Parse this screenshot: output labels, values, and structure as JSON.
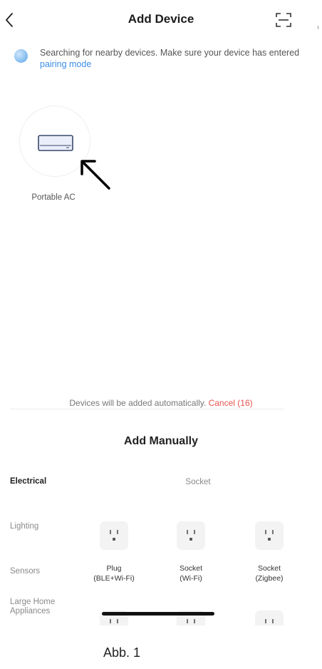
{
  "header": {
    "title": "Add Device",
    "back_icon": "chevron-left-icon",
    "scan_icon": "scan-icon"
  },
  "notice": {
    "text": "Searching for nearby devices. Make sure your device has entered",
    "link": "pairing mode"
  },
  "found_devices": [
    {
      "label": "Portable AC",
      "icon": "air-conditioner-icon"
    }
  ],
  "auto_add": {
    "text": "Devices will be added automatically.",
    "cancel": "Cancel (16)"
  },
  "manual": {
    "title": "Add Manually",
    "categories": [
      "Electrical",
      "Lighting",
      "Sensors",
      "Large Home Appliances"
    ],
    "active_category": "Electrical",
    "section_heading": "Socket",
    "products": [
      {
        "line1": "Plug",
        "line2": "(BLE+Wi-Fi)"
      },
      {
        "line1": "Socket",
        "line2": "(Wi-Fi)"
      },
      {
        "line1": "Socket",
        "line2": "(Zigbee)"
      }
    ]
  },
  "caption": "Abb. 1",
  "colors": {
    "accent_link": "#3d8ee6",
    "cancel": "#e8534e",
    "text_muted": "#8a8a8a"
  }
}
